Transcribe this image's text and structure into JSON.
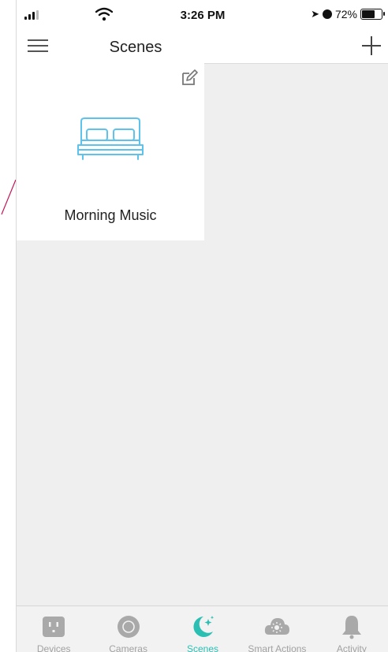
{
  "status_bar": {
    "time": "3:26 PM",
    "battery_percent": "72%",
    "battery_level": 0.72
  },
  "header": {
    "title": "Scenes"
  },
  "scenes": [
    {
      "label": "Morning Music",
      "icon": "bed-icon"
    }
  ],
  "tabs": [
    {
      "label": "Devices",
      "icon": "outlet-icon",
      "active": false
    },
    {
      "label": "Cameras",
      "icon": "camera-icon",
      "active": false
    },
    {
      "label": "Scenes",
      "icon": "scenes-moon-icon",
      "active": true
    },
    {
      "label": "Smart Actions",
      "icon": "smart-actions-cloud-icon",
      "active": false
    },
    {
      "label": "Activity",
      "icon": "bell-icon",
      "active": false
    }
  ],
  "colors": {
    "accent": "#2bbfb4",
    "bed_icon": "#5ec3ec",
    "background": "#efefef",
    "annotation_line": "#c2185b"
  }
}
